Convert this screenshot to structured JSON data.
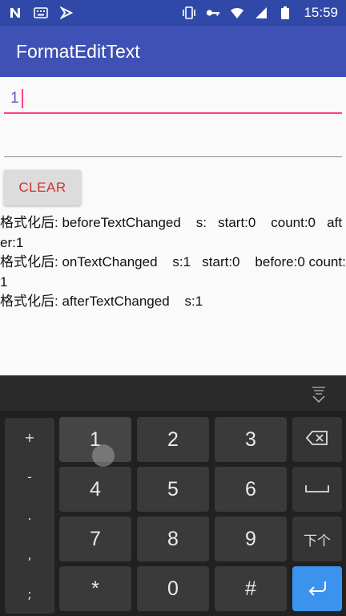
{
  "statusbar": {
    "icons_left": [
      "n-icon",
      "keyboard-icon",
      "check-icon"
    ],
    "icons_right": [
      "vibrate-icon",
      "key-icon",
      "wifi-icon",
      "signal-icon",
      "battery-icon"
    ],
    "time": "15:59"
  },
  "appbar": {
    "title": "FormatEditText"
  },
  "edit1": {
    "value": "1"
  },
  "edit2": {
    "value": ""
  },
  "clear_button": {
    "label": "CLEAR"
  },
  "log_lines": [
    "格式化后: beforeTextChanged    s:   start:0    count:0   after:1",
    "格式化后: onTextChanged    s:1   start:0    before:0 count:1",
    "格式化后: afterTextChanged    s:1"
  ],
  "keyboard": {
    "symbols": [
      "+",
      "-",
      ".",
      ",",
      ";"
    ],
    "keys": [
      "1",
      "2",
      "3",
      "4",
      "5",
      "6",
      "7",
      "8",
      "9",
      "*",
      "0",
      "#"
    ],
    "function_keys": {
      "next_label": "下个"
    },
    "colors": {
      "enter": "#3b93ee",
      "accent": "#ff4081"
    }
  },
  "colors": {
    "appbar": "#3f51b5",
    "statusbar": "#3049a8",
    "clear_text": "#d32f2f"
  }
}
